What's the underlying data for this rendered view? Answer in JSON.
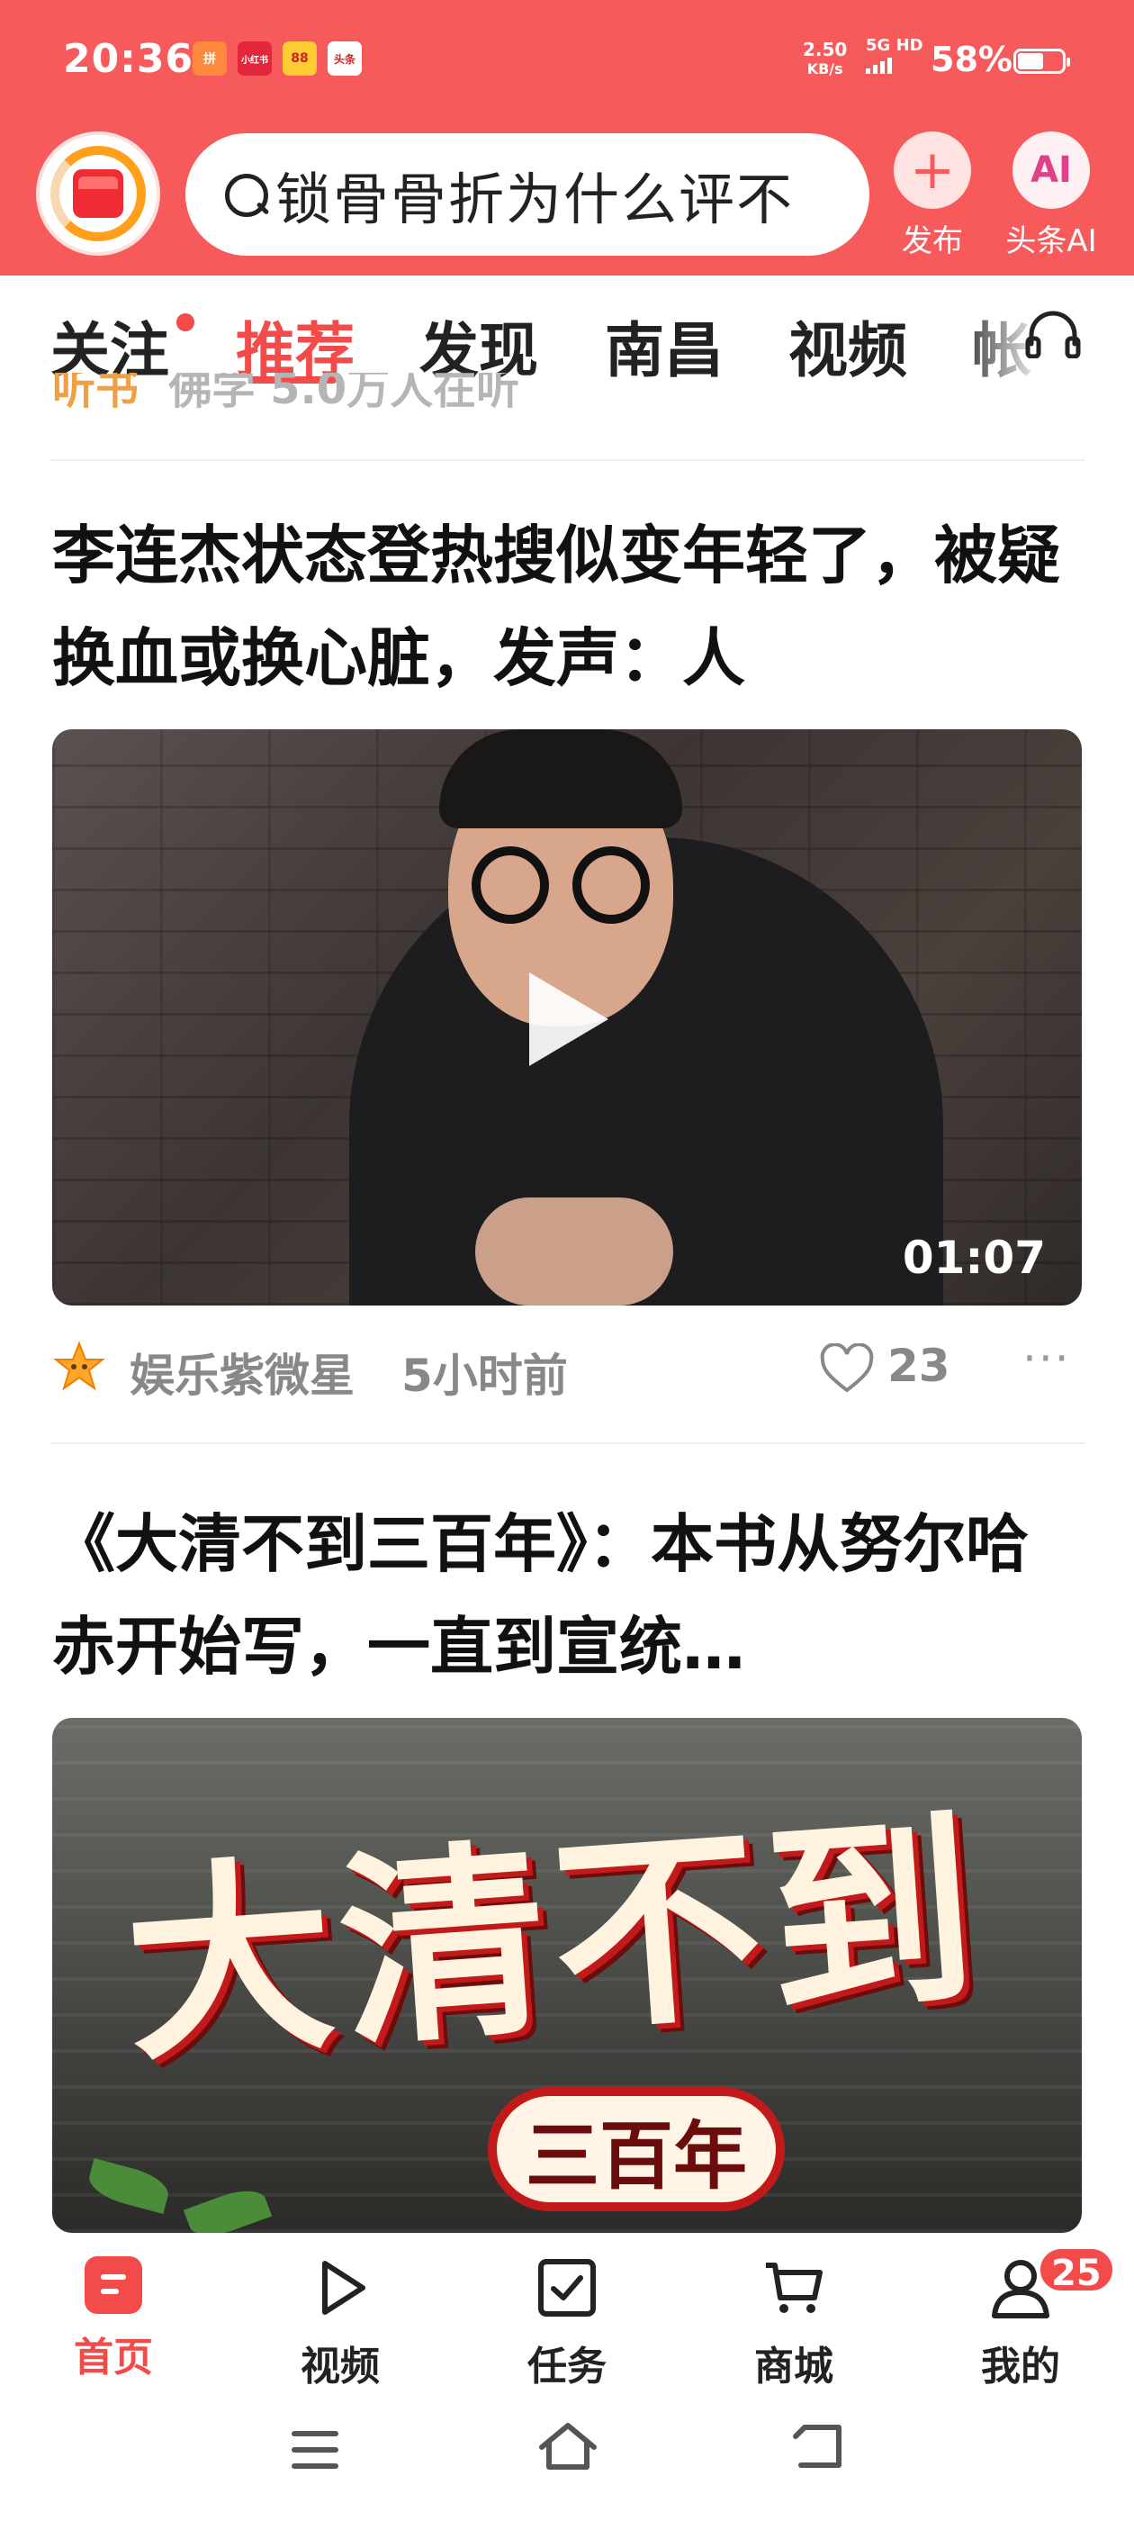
{
  "status_bar": {
    "time": "20:36",
    "app_icons": [
      "拼",
      "小红书",
      "88",
      "头条"
    ],
    "net_speed_value": "2.50",
    "net_speed_unit": "KB/s",
    "network": "5G HD",
    "battery": "58%"
  },
  "header": {
    "search_text": "锁骨骨折为什么评不",
    "publish_label": "发布",
    "ai_label": "头条AI",
    "ai_icon_text": "AI"
  },
  "tabs": [
    {
      "label": "关注"
    },
    {
      "label": "推荐"
    },
    {
      "label": "发现"
    },
    {
      "label": "南昌"
    },
    {
      "label": "视频"
    },
    {
      "label": "帐"
    }
  ],
  "feed": {
    "peek_title": "听书",
    "peek_meta": "佛学 5.0万人在听",
    "articles": [
      {
        "title": "李连杰状态登热搜似变年轻了，被疑换血或换心脏，发声：人",
        "duration": "01:07",
        "source": "娱乐紫微星",
        "time": "5小时前",
        "likes": "23"
      },
      {
        "title": "《大清不到三百年》：本书从努尔哈赤开始写，一直到宣统…",
        "image_title": "大清不到",
        "image_badge": "三百年"
      }
    ]
  },
  "bottom_nav": {
    "items": [
      {
        "label": "首页"
      },
      {
        "label": "视频"
      },
      {
        "label": "任务"
      },
      {
        "label": "商城"
      },
      {
        "label": "我的"
      }
    ],
    "profile_badge": "25"
  },
  "colors": {
    "brand_red": "#f65a5a",
    "active_tab": "#f34a4a",
    "meta_gray": "#888888"
  }
}
